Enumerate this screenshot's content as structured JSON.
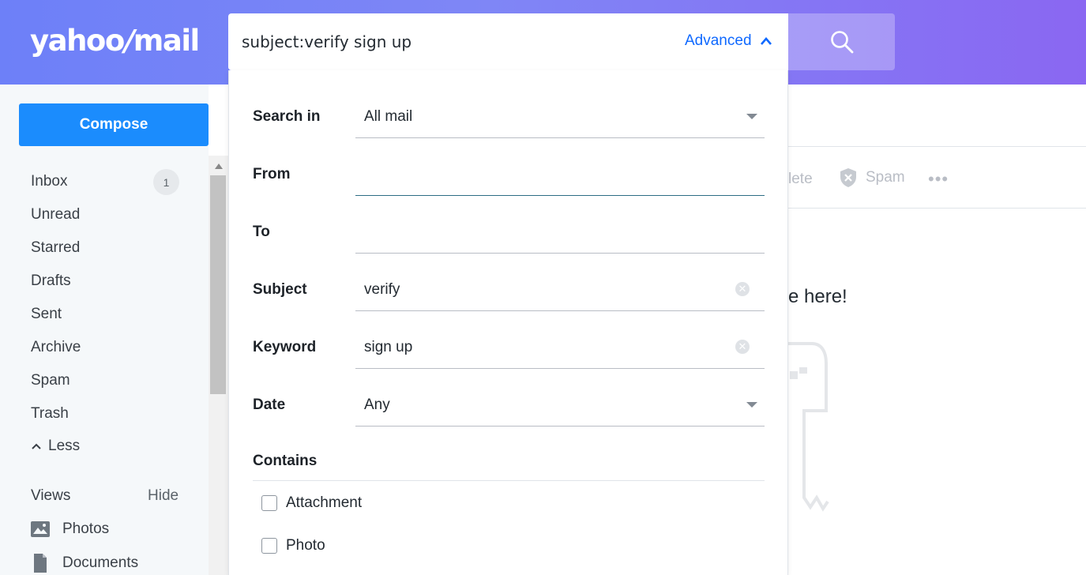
{
  "header": {
    "logo_text": "yahoo",
    "logo_slash": "/",
    "logo_mail": "mail",
    "search_value": "subject:verify sign up",
    "advanced_label": "Advanced",
    "search_icon": "search-icon"
  },
  "sidebar": {
    "compose_label": "Compose",
    "folders": [
      {
        "label": "Inbox",
        "count": "1"
      },
      {
        "label": "Unread"
      },
      {
        "label": "Starred"
      },
      {
        "label": "Drafts"
      },
      {
        "label": "Sent"
      },
      {
        "label": "Archive"
      },
      {
        "label": "Spam"
      },
      {
        "label": "Trash"
      }
    ],
    "less_label": "Less",
    "views_label": "Views",
    "hide_label": "Hide",
    "views": [
      {
        "label": "Photos",
        "icon": "photo-icon"
      },
      {
        "label": "Documents",
        "icon": "document-icon"
      }
    ]
  },
  "main": {
    "delete_partial": "lete",
    "spam_label": "Spam",
    "more_label": "•••",
    "empty_message_partial": "e here!"
  },
  "advanced_search": {
    "search_in_label": "Search in",
    "search_in_value": "All mail",
    "from_label": "From",
    "from_value": "",
    "to_label": "To",
    "to_value": "",
    "subject_label": "Subject",
    "subject_value": "verify",
    "keyword_label": "Keyword",
    "keyword_value": "sign up",
    "date_label": "Date",
    "date_value": "Any",
    "contains_label": "Contains",
    "contains_options": [
      {
        "label": "Attachment",
        "checked": false
      },
      {
        "label": "Photo",
        "checked": false
      }
    ]
  },
  "colors": {
    "header_gradient_start": "#6d80f8",
    "header_gradient_end": "#8a67f2",
    "compose_blue": "#1b8cfd",
    "advanced_link": "#0f69ff"
  }
}
